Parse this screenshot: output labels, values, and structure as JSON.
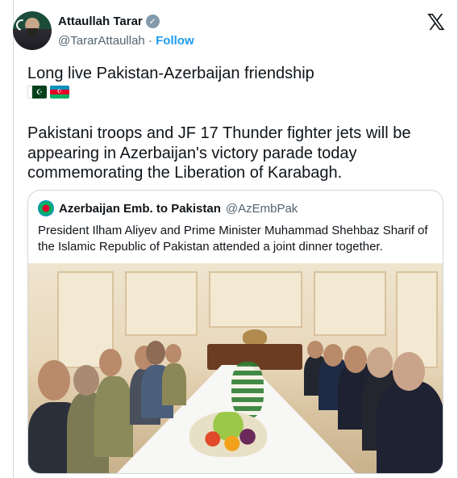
{
  "tweet": {
    "author_name": "Attaullah Tarar",
    "author_handle": "@TararAttaullah",
    "separator": "·",
    "follow_label": "Follow",
    "x_logo": "𝕏",
    "line1": "Long live Pakistan-Azerbaijan friendship",
    "body": "Pakistani troops and JF 17 Thunder fighter jets will be appearing in Azerbaijan's victory parade today commemorating the Liberation of Karabagh."
  },
  "flags": [
    "flag-pakistan",
    "flag-azerbaijan"
  ],
  "quoted_tweet": {
    "author_name": "Azerbaijan Emb. to Pakistan",
    "author_handle": "@AzEmbPak",
    "text": "President Ilham Aliyev and Prime Minister Muhammad Shehbaz Sharif of the Islamic Republic of Pakistan attended a joint dinner together."
  },
  "colors": {
    "link_blue": "#1d9bf0",
    "muted_text": "#536471",
    "border": "#cfd9de",
    "verified_badge": "#829aab"
  }
}
